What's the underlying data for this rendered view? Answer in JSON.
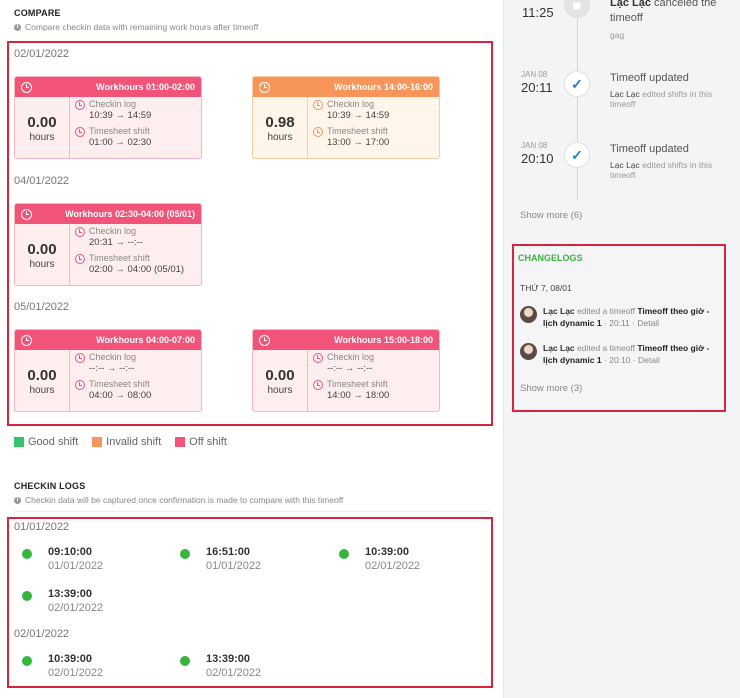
{
  "compare": {
    "title": "COMPARE",
    "subtitle": "Compare checkin data with remaining work hours after timeoff",
    "groups": [
      {
        "date": "02/01/2022",
        "cards": [
          {
            "status": "off",
            "workhours": "Workhours 01:00-02:00",
            "hours": "0.00",
            "unit": "hours",
            "checkin_label": "Checkin log",
            "checkin_value": "10:39 → 14:59",
            "timesheet_label": "Timesheet shift",
            "timesheet_value": "01:00 → 02:30"
          },
          {
            "status": "invalid",
            "workhours": "Workhours 14:00-16:00",
            "hours": "0.98",
            "unit": "hours",
            "checkin_label": "Checkin log",
            "checkin_value": "10:39 → 14:59",
            "timesheet_label": "Timesheet shift",
            "timesheet_value": "13:00 → 17:00"
          }
        ]
      },
      {
        "date": "04/01/2022",
        "cards": [
          {
            "status": "off",
            "workhours": "Workhours 02:30-04:00 (05/01)",
            "hours": "0.00",
            "unit": "hours",
            "checkin_label": "Checkin log",
            "checkin_value": "20:31 → --:--",
            "timesheet_label": "Timesheet shift",
            "timesheet_value": "02:00 → 04:00 (05/01)"
          }
        ]
      },
      {
        "date": "05/01/2022",
        "cards": [
          {
            "status": "off",
            "workhours": "Workhours 04:00-07:00",
            "hours": "0.00",
            "unit": "hours",
            "checkin_label": "Checkin log",
            "checkin_value": "--:-- → --:--",
            "timesheet_label": "Timesheet shift",
            "timesheet_value": "04:00 → 08:00"
          },
          {
            "status": "off",
            "workhours": "Workhours 15:00-18:00",
            "hours": "0.00",
            "unit": "hours",
            "checkin_label": "Checkin log",
            "checkin_value": "--:-- → --:--",
            "timesheet_label": "Timesheet shift",
            "timesheet_value": "14:00 → 18:00"
          }
        ]
      }
    ],
    "legend": [
      {
        "label": "Good shift",
        "color": "#35c46b"
      },
      {
        "label": "Invalid shift",
        "color": "#f8955a"
      },
      {
        "label": "Off shift",
        "color": "#f25479"
      }
    ]
  },
  "checkin_logs": {
    "title": "CHECKIN LOGS",
    "subtitle": "Checkin data will be captured once confirmation is made to compare with this timeoff",
    "groups": [
      {
        "date": "01/01/2022",
        "logs": [
          {
            "time": "09:10:00",
            "date": "01/01/2022"
          },
          {
            "time": "16:51:00",
            "date": "01/01/2022"
          },
          {
            "time": "10:39:00",
            "date": "02/01/2022"
          },
          {
            "time": "13:39:00",
            "date": "02/01/2022"
          }
        ]
      },
      {
        "date": "02/01/2022",
        "logs": [
          {
            "time": "10:39:00",
            "date": "02/01/2022"
          },
          {
            "time": "13:39:00",
            "date": "02/01/2022"
          }
        ]
      }
    ]
  },
  "timeline": {
    "items": [
      {
        "date": "",
        "time": "11:25",
        "title_name": "Lạc Lạc",
        "title_rest": " canceled the",
        "title_line2": "timeoff",
        "sub": "gag"
      },
      {
        "date": "JAN 08",
        "time": "20:11",
        "title": "Timeoff updated",
        "sub_name": "Lạc Lạc",
        "sub_rest": " edited shifts in this",
        "sub_line2": "timeoff"
      },
      {
        "date": "JAN 08",
        "time": "20:10",
        "title": "Timeoff updated",
        "sub_name": "Lạc Lạc",
        "sub_rest": " edited shifts in this",
        "sub_line2": "timeoff"
      }
    ],
    "show_more": "Show more (6)"
  },
  "changelogs": {
    "title": "CHANGELOGS",
    "day": "THỨ 7, 08/01",
    "items": [
      {
        "name": "Lạc Lạc",
        "action": " edited a timeoff ",
        "target": "Timeoff theo giờ -",
        "target2": "lịch dynamic 1",
        "meta": " · 20:11 · Detail"
      },
      {
        "name": "Lạc Lạc",
        "action": " edited a timeoff ",
        "target": "Timeoff theo giờ -",
        "target2": "lịch dynamic 1",
        "meta": " · 20:10 · Detail"
      }
    ],
    "show_more": "Show more (3)"
  }
}
